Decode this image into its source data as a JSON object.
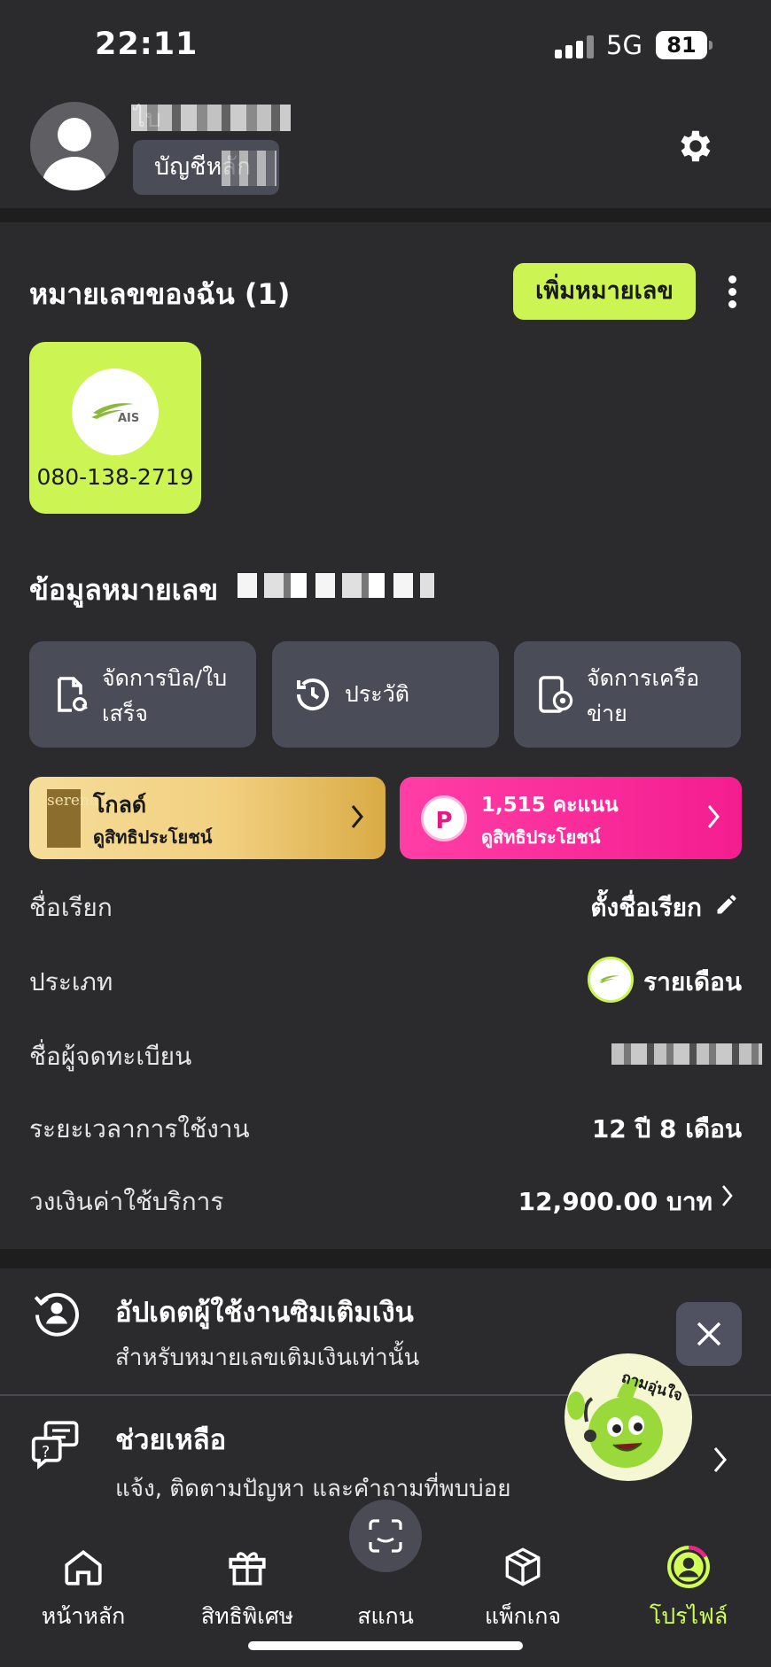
{
  "status_bar": {
    "time": "22:11",
    "network": "5G",
    "battery": "81"
  },
  "profile": {
    "name": "ไบ",
    "account_chip": "บัญชีหลัก"
  },
  "my_numbers": {
    "title": "หมายเลขของฉัน (1)",
    "add_button": "เพิ่มหมายเลข",
    "cards": [
      {
        "logo_text": "AIS",
        "number": "080-138-2719"
      }
    ]
  },
  "number_info": {
    "title": "ข้อมูลหมายเลข"
  },
  "actions": [
    {
      "label": "จัดการบิล/ใบเสร็จ",
      "icon": "bill-icon"
    },
    {
      "label": "ประวัติ",
      "icon": "history-icon"
    },
    {
      "label": "จัดการเครือข่าย",
      "icon": "network-settings-icon"
    }
  ],
  "benefits": {
    "gold": {
      "title": "โกลด์",
      "subtitle": "ดูสิทธิประโยชน์",
      "brand": "serenade"
    },
    "points": {
      "title": "1,515 คะแนน",
      "subtitle": "ดูสิทธิประโยชน์",
      "badge": "P"
    }
  },
  "details": {
    "nickname_label": "ชื่อเรียก",
    "nickname_value": "ตั้งชื่อเรียก",
    "type_label": "ประเภท",
    "type_value": "รายเดือน",
    "owner_label": "ชื่อผู้จดทะเบียน",
    "duration_label": "ระยะเวลาการใช้งาน",
    "duration_value": "12 ปี 8 เดือน",
    "credit_label": "วงเงินค่าใช้บริการ",
    "credit_value": "12,900.00 บาท"
  },
  "promos": {
    "update": {
      "title": "อัปเดตผู้ใช้งานซิมเติมเงิน",
      "subtitle": "สำหรับหมายเลขเติมเงินเท่านั้น"
    },
    "help": {
      "title": "ช่วยเหลือ",
      "subtitle": "แจ้ง, ติดตามปัญหา และคำถามที่พบบ่อย"
    },
    "mascot_label": "ถามอุ่นใจ"
  },
  "nav": [
    {
      "label": "หน้าหลัก",
      "icon": "home-icon"
    },
    {
      "label": "สิทธิพิเศษ",
      "icon": "gift-icon"
    },
    {
      "label": "สแกน",
      "icon": "scan-icon"
    },
    {
      "label": "แพ็กเกจ",
      "icon": "package-icon"
    },
    {
      "label": "โปรไฟล์",
      "icon": "profile-icon"
    }
  ],
  "colors": {
    "accent": "#ccf452",
    "active_nav": "#d2ff55",
    "tile": "#4a4c58",
    "points_pink": "#f41d90"
  }
}
